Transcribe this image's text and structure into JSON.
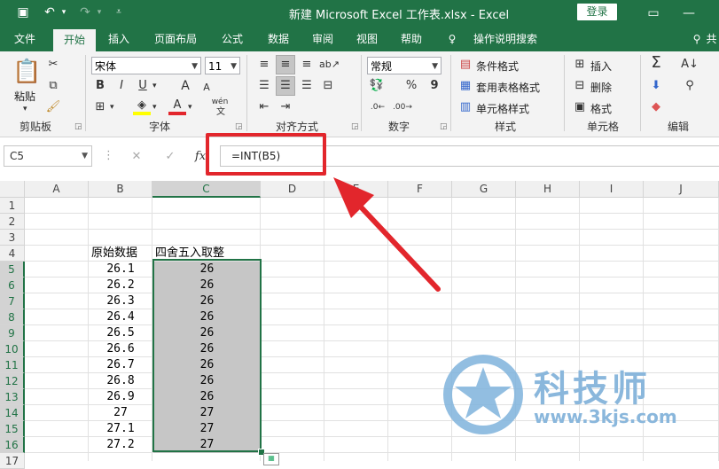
{
  "window": {
    "title": "新建 Microsoft Excel 工作表.xlsx  -  Excel",
    "login_label": "登录",
    "accent": "#217346"
  },
  "tabs": [
    "文件",
    "开始",
    "插入",
    "页面布局",
    "公式",
    "数据",
    "审阅",
    "视图",
    "帮助",
    "操作说明搜索",
    "共"
  ],
  "ribbon": {
    "clipboard": {
      "paste": "粘贴",
      "label": "剪贴板"
    },
    "font": {
      "name": "宋体",
      "size": "11",
      "label": "字体",
      "bold": "B",
      "italic": "I",
      "underline": "U",
      "grow": "A",
      "shrink": "A",
      "phonetic": "wén"
    },
    "alignment": {
      "label": "对齐方式"
    },
    "number": {
      "format": "常规",
      "percent": "%",
      "comma": "9",
      "label": "数字"
    },
    "styles": {
      "cond_format": "条件格式",
      "table_format": "套用表格格式",
      "cell_styles": "单元格样式",
      "label": "样式"
    },
    "cells": {
      "insert": "插入",
      "delete": "删除",
      "format": "格式",
      "label": "单元格"
    },
    "editing": {
      "sum": "Σ",
      "label": "编辑"
    }
  },
  "formula_bar": {
    "name_box": "C5",
    "fx": "fx",
    "formula": "=INT(B5)"
  },
  "grid": {
    "columns": [
      "A",
      "B",
      "C",
      "D",
      "E",
      "F",
      "G",
      "H",
      "I",
      "J"
    ],
    "rows": [
      "1",
      "2",
      "3",
      "4",
      "5",
      "6",
      "7",
      "8",
      "9",
      "10",
      "11",
      "12",
      "13",
      "14",
      "15",
      "16",
      "17"
    ],
    "header_b": "原始数据",
    "header_c": "四舍五入取整",
    "b_values": [
      "26.1",
      "26.2",
      "26.3",
      "26.4",
      "26.5",
      "26.6",
      "26.7",
      "26.8",
      "26.9",
      "27",
      "27.1",
      "27.2"
    ],
    "c_values": [
      "26",
      "26",
      "26",
      "26",
      "26",
      "26",
      "26",
      "26",
      "26",
      "27",
      "27",
      "27"
    ]
  },
  "watermark": {
    "brand": "科技师",
    "url": "www.3kjs.com"
  }
}
